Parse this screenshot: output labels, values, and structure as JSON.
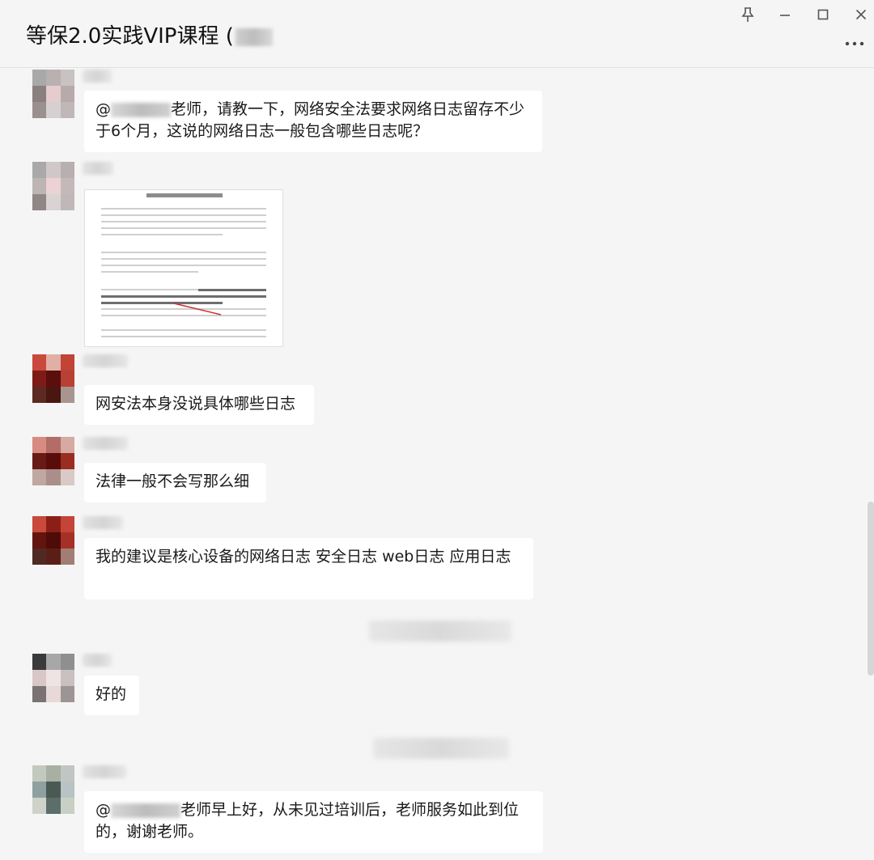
{
  "window": {
    "title": "等保2.0实践VIP课程 (",
    "controls": [
      "pin-icon",
      "minimize-icon",
      "maximize-icon",
      "close-icon",
      "more-icon"
    ]
  },
  "messages": [
    {
      "type": "text",
      "prefix": "@",
      "text": "老师，请教一下，网络安全法要求网络日志留存不少于6个月，这说的网络日志一般包含哪些日志呢？"
    },
    {
      "type": "image",
      "description_icon": "document-image-icon"
    },
    {
      "type": "text",
      "text": "网安法本身没说具体哪些日志"
    },
    {
      "type": "text",
      "text": "法律一般不会写那么细"
    },
    {
      "type": "text",
      "text": "我的建议是核心设备的网络日志  安全日志  web日志  应用日志"
    },
    {
      "type": "text",
      "text": "好的"
    },
    {
      "type": "text",
      "prefix": "@",
      "text": "老师早上好，从未见过培训后，老师服务如此到位的，谢谢老师。"
    }
  ],
  "colors": {
    "background": "#f5f5f5",
    "bubble": "#ffffff",
    "divider": "#e2e2e2"
  }
}
